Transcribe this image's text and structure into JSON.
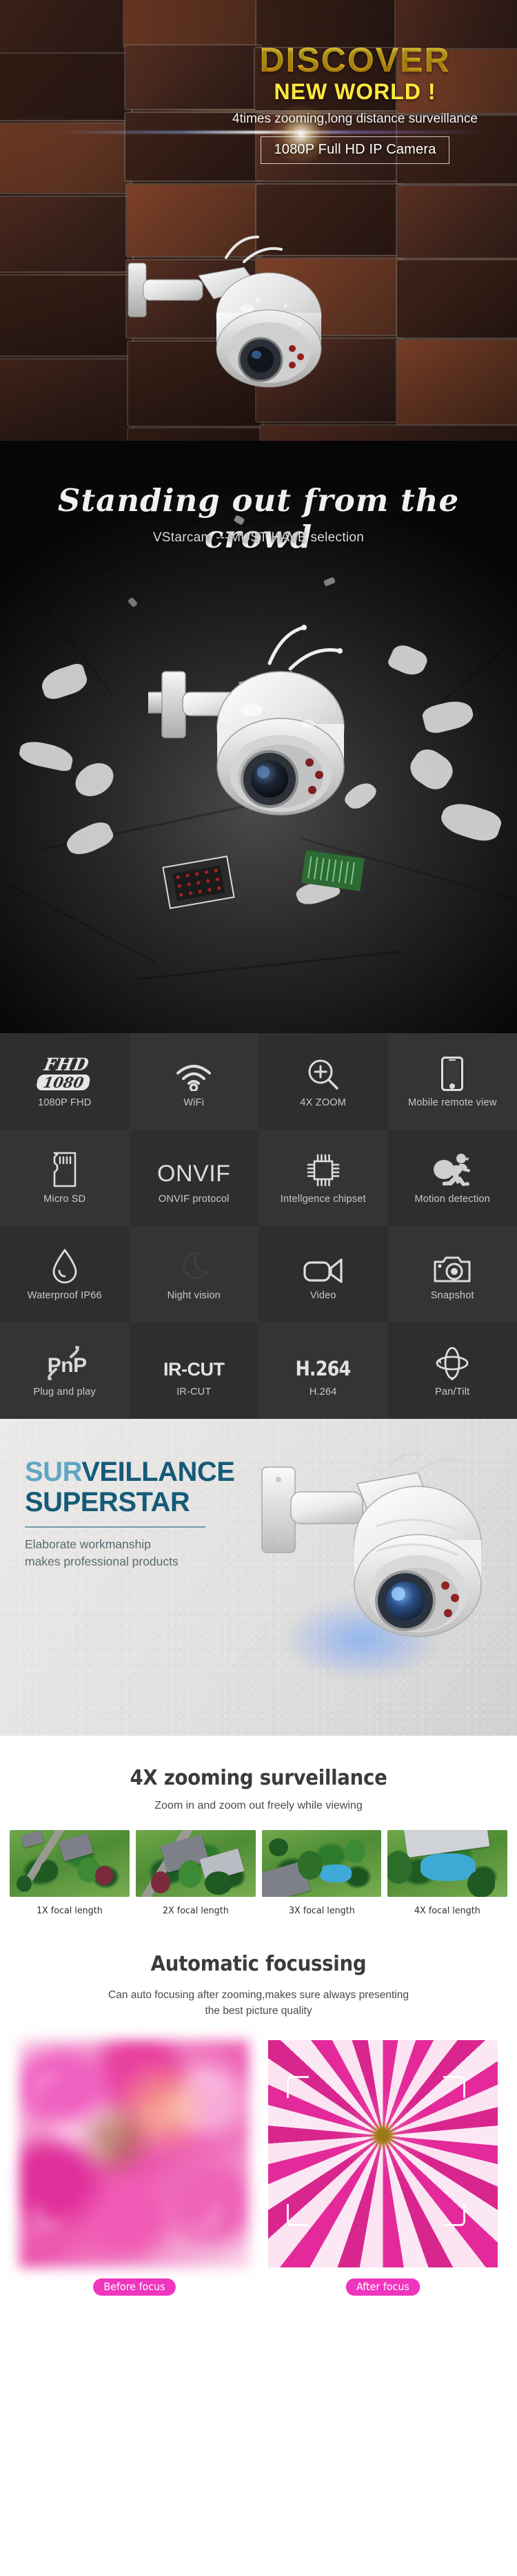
{
  "hero": {
    "headline": "DISCOVER",
    "subheadline": "NEW WORLD !",
    "tagline": "4times  zooming,long distance surveillance",
    "badge": "1080P Full HD IP Camera"
  },
  "dark_banner": {
    "script_title": "Standing out from the crowd",
    "brand_line": "VStarcam  ---MUST HAVE selection"
  },
  "features": {
    "items": [
      {
        "icon": "fhd-1080-icon",
        "label": "1080P FHD",
        "icon_text_top": "FHD",
        "icon_text_bottom": "1080"
      },
      {
        "icon": "wifi-icon",
        "label": "WiFi"
      },
      {
        "icon": "zoom-in-icon",
        "label": "4X ZOOM"
      },
      {
        "icon": "smartphone-icon",
        "label": "Mobile remote view"
      },
      {
        "icon": "micro-sd-card-icon",
        "label": "Micro SD"
      },
      {
        "icon": "onvif-wordmark-icon",
        "label": "ONVIF protocol",
        "icon_text": "ONVIF"
      },
      {
        "icon": "chipset-icon",
        "label": "Intellgence chipset"
      },
      {
        "icon": "running-person-icon",
        "label": "Motion detection"
      },
      {
        "icon": "water-drop-icon",
        "label": "Waterproof IP66"
      },
      {
        "icon": "night-vision-icon",
        "label": "Night vision"
      },
      {
        "icon": "video-camera-icon",
        "label": "Video"
      },
      {
        "icon": "photo-camera-icon",
        "label": "Snapshot"
      },
      {
        "icon": "pnp-wordmark-icon",
        "label": "Plug and play",
        "icon_text": "PnP"
      },
      {
        "icon": "ir-cut-wordmark-icon",
        "label": "IR-CUT",
        "icon_text": "IR-CUT"
      },
      {
        "icon": "h264-wordmark-icon",
        "label": "H.264",
        "icon_text": "H.264"
      },
      {
        "icon": "pan-tilt-icon",
        "label": "Pan/Tilt"
      }
    ]
  },
  "superstar": {
    "title_part1": "SUR",
    "title_part2": "VEILLANCE",
    "title_line2": "SUPERSTAR",
    "body_line1": "Elaborate workmanship",
    "body_line2": "makes professional products",
    "accent_light": "#5fa7c4",
    "accent_dark": "#155b78"
  },
  "zoom_section": {
    "title": "4X zooming surveillance",
    "subtitle": "Zoom in and zoom out freely while viewing",
    "shots": [
      {
        "caption": "1X focal length"
      },
      {
        "caption": "2X focal length"
      },
      {
        "caption": "3X focal length"
      },
      {
        "caption": "4X focal length"
      }
    ]
  },
  "focus_section": {
    "title": "Automatic focussing",
    "subtitle_line1": "Can auto focusing after zooming,makes sure always presenting",
    "subtitle_line2": "the best picture quality",
    "badge_color": "#f035bf",
    "items": [
      {
        "badge": "Before focus"
      },
      {
        "badge": "After focus"
      }
    ]
  }
}
